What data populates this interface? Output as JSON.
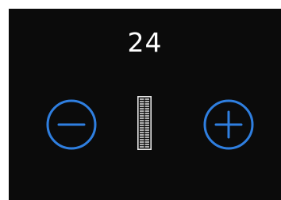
{
  "control": {
    "value": "24",
    "decrease_icon": "minus-circle-icon",
    "increase_icon": "plus-circle-icon",
    "stitch_icon": "buttonhole-stitch-icon",
    "accent_color": "#2f7fe0",
    "background_color": "#0b0b0b",
    "text_color": "#ffffff"
  }
}
